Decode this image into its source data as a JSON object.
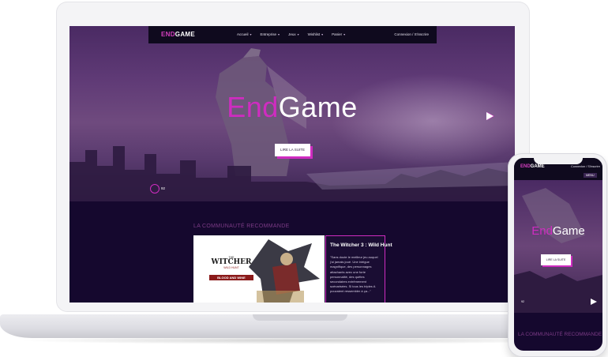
{
  "brand": {
    "name_accent": "End",
    "name_rest": "Game",
    "nav_logo_accent": "END",
    "nav_logo_rest": "GAME",
    "accent_color": "#cf2cc0",
    "background_color": "#15082e"
  },
  "nav": {
    "items": [
      {
        "label": "Accueil",
        "icon": "chevron-down-icon"
      },
      {
        "label": "Entreprise",
        "icon": "chevron-down-icon"
      },
      {
        "label": "Jeux",
        "icon": "chevron-down-icon"
      },
      {
        "label": "Wishlist",
        "icon": "chevron-down-icon"
      },
      {
        "label": "Panier",
        "icon": "chevron-down-icon"
      }
    ],
    "login_label": "Connexion / S'inscrire"
  },
  "hero": {
    "button_label": "LIRE LA SUITE",
    "gauge_label": "92"
  },
  "section": {
    "heading": "LA COMMUNAUTÉ RECOMMANDE"
  },
  "card": {
    "title": "The Witcher 3 : Wild Hunt",
    "description": "\"Sans doute le meilleur jeu auquel j'ai jamais joué. Une intrigue magnifique, des personnages attachants avec une forte personnalité, des quêtes secondaires extrêmement scénarisées. Si tous les triples A pouvaient ressembler à ça...\"",
    "image": {
      "logo_line1": "THE",
      "logo_line2": "WITCHER",
      "logo_line3": "WILD HUNT",
      "banner": "BLOOD AND WINE"
    }
  },
  "mobile": {
    "logo_accent": "END",
    "logo_rest": "GAME",
    "login_label": "Connexion / S'inscrire",
    "menu_label": "MENU",
    "title_accent": "End",
    "title_rest": "Game",
    "button_label": "LIRE LA SUITE",
    "gauge_label": "92",
    "heading": "LA COMMUNAUTÉ RECOMMANDE"
  }
}
